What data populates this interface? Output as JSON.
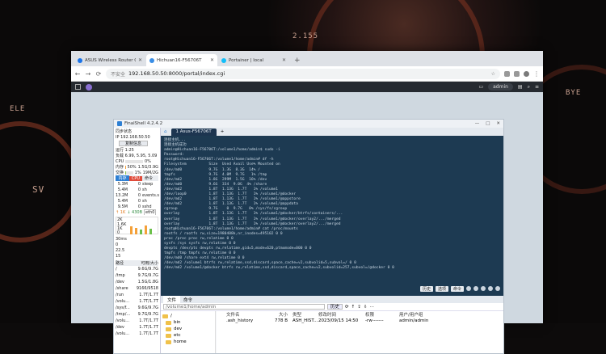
{
  "wallpaper": {
    "labels": [
      "2.155",
      "ELE",
      "SV",
      "BYE"
    ]
  },
  "browser": {
    "tabs": [
      {
        "label": "ASUS Wireless Router GT-AX11000",
        "icon_color": "#1a73e8",
        "active": false
      },
      {
        "label": "Hichuan16-F56706T",
        "icon_color": "#3a8ee6",
        "active": true
      },
      {
        "label": "Portainer | local",
        "icon_color": "#13bef9",
        "active": false
      }
    ],
    "new_tab": "+",
    "nav": {
      "back": "←",
      "forward": "→",
      "reload": "⟳"
    },
    "security": "不安全",
    "url": "192.168.50.50:8000/portal/index.cgi",
    "star": "☆"
  },
  "dsm": {
    "user": "admin"
  },
  "finalshell": {
    "title": "FinalShell 4.2.4.2",
    "window_controls": [
      "—",
      "□",
      "✕"
    ],
    "side": {
      "sync": "同步状态",
      "ip": "IP  192.168.50.50",
      "copy": "复制信息",
      "uptime": "运行 1:25",
      "load": "负载 6.99, 5.95, 5.09",
      "cpu": {
        "label": "CPU",
        "value": "0%",
        "frac": 0.0,
        "color": "#6cc04a"
      },
      "mem": {
        "label": "内存",
        "pct": "50%",
        "value": "1.5G/3.9G",
        "frac": 0.5,
        "color": "#f4a13a"
      },
      "swap": {
        "label": "交换",
        "pct": "1%",
        "value": "19M/2G",
        "frac": 0.01,
        "color": "#8bc34a"
      },
      "proc_header": [
        "内存",
        "CPU",
        "命令"
      ],
      "procs": [
        [
          "5.3M",
          "0",
          "sleep"
        ],
        [
          "5.4M",
          "0",
          "sh"
        ],
        [
          "13.2M",
          "0",
          "events.s"
        ],
        [
          "5.4M",
          "0",
          "sh"
        ],
        [
          "9.5M",
          "0",
          "sshd"
        ]
      ],
      "net": {
        "up": "↑ 1K",
        "down": "↓ 430B",
        "iface": "eth0"
      },
      "net_scale": [
        "2K",
        "1.6K",
        "1K",
        "0"
      ],
      "latency": {
        "label": "30ms",
        "values": [
          "0",
          "22.5",
          "15"
        ]
      },
      "disk_header": [
        "路径",
        "可用/大小"
      ],
      "disks": [
        [
          "/",
          "9.6G/9.7G"
        ],
        [
          "/tmp",
          "9.7G/9.7G"
        ],
        [
          "/dev",
          "1.5G/1.8G"
        ],
        [
          "/share",
          "9166/9518"
        ],
        [
          "/run",
          "1.7T/1.7T"
        ],
        [
          "/volu...",
          "1.7T/1.7T"
        ],
        [
          "/sys/f...",
          "9.6G/9.7G"
        ],
        [
          "/tmp/...",
          "9.7G/9.7G"
        ],
        [
          "/volu...",
          "1.7T/1.7T"
        ],
        [
          "/dev",
          "1.7T/1.7T"
        ],
        [
          "/volu...",
          "1.7T/1.7T"
        ]
      ]
    },
    "session_tab": "1 Asus-F56706T",
    "terminal_lines": [
      "连接主机...",
      "连接主机成功",
      "admin@Hichuan16-F56706T:/volume1/home/admin$ sudo -i",
      "Password:",
      "root@Hichuan16-F56706T:/volume1/home/admin# df -h",
      "Filesystem          Size  Used Avail Use% Mounted on",
      "/dev/md0            9.7G  1.3G  8.3G  14% /",
      "tmpfs               9.7G  4.0M  9.7G   1% /tmp",
      "/dev/md2            1.8G  299M  1.5G  16% /dev",
      "/dev/md0            9.6G  334  9.0G  4% /share",
      "/dev/md2            1.8T  1.13G  1.7T   1% /volume1",
      "/dev/loop0          1.8T  1.13G  1.7T   1% /volume1/@docker",
      "/dev/md2            1.8T  1.13G  1.7T   1% /volume1/@appstore",
      "/dev/md2            1.8T  1.13G  1.7T   1% /volume1/@appdata",
      "cgroup              9.7G    0  9.7G   0% /sys/fs/cgroup",
      "overlay             1.8T  1.13G  1.7T   1% /volume1/@docker/btrfs/containers/...",
      "overlay             1.8T  1.13G  1.7T   1% /volume1/@docker/overlay2/.../merged",
      "overlay             1.8T  1.13G  1.7T   1% /volume1/@docker/overlay2/.../merged",
      "root@Hichuan16-F56706T:/volume1/home/admin# cat /proc/mounts",
      "rootfs / rootfs rw,size=1980408k,nr_inodes=495102 0 0",
      "proc /proc proc rw,relatime 0 0",
      "sysfs /sys sysfs rw,relatime 0 0",
      "devpts /dev/pts devpts rw,relatime,gid=5,mode=620,ptmxmode=000 0 0",
      "tmpfs /tmp tmpfs rw,relatime 0 0",
      "/dev/md0 /share ext4 rw,relatime 0 0",
      "/dev/md2 /volume1 btrfs rw,relatime,ssd,discard,space_cache=v2,subvolid=5,subvol=/ 0 0",
      "/dev/md2 /volume1/@docker btrfs rw,relatime,ssd,discard,space_cache=v2,subvolid=257,subvol=/@docker 0 0"
    ],
    "term_buttons": [
      "历史",
      "选项",
      "命令"
    ],
    "file_tabs": [
      "文件",
      "命令"
    ],
    "path": "/volume1/home/admin",
    "history_btn": "历史",
    "tree": [
      "/",
      "bin",
      "dev",
      "etc",
      "home"
    ],
    "file_header": [
      "文件名",
      "大小",
      "类型",
      "修改时间",
      "权限",
      "用户/用户组"
    ],
    "files": [
      [
        ".ash_history",
        "778 B",
        "ASH_HIST...",
        "2023/09/15 14:50",
        "-rw-------",
        "admin/admin"
      ]
    ]
  }
}
